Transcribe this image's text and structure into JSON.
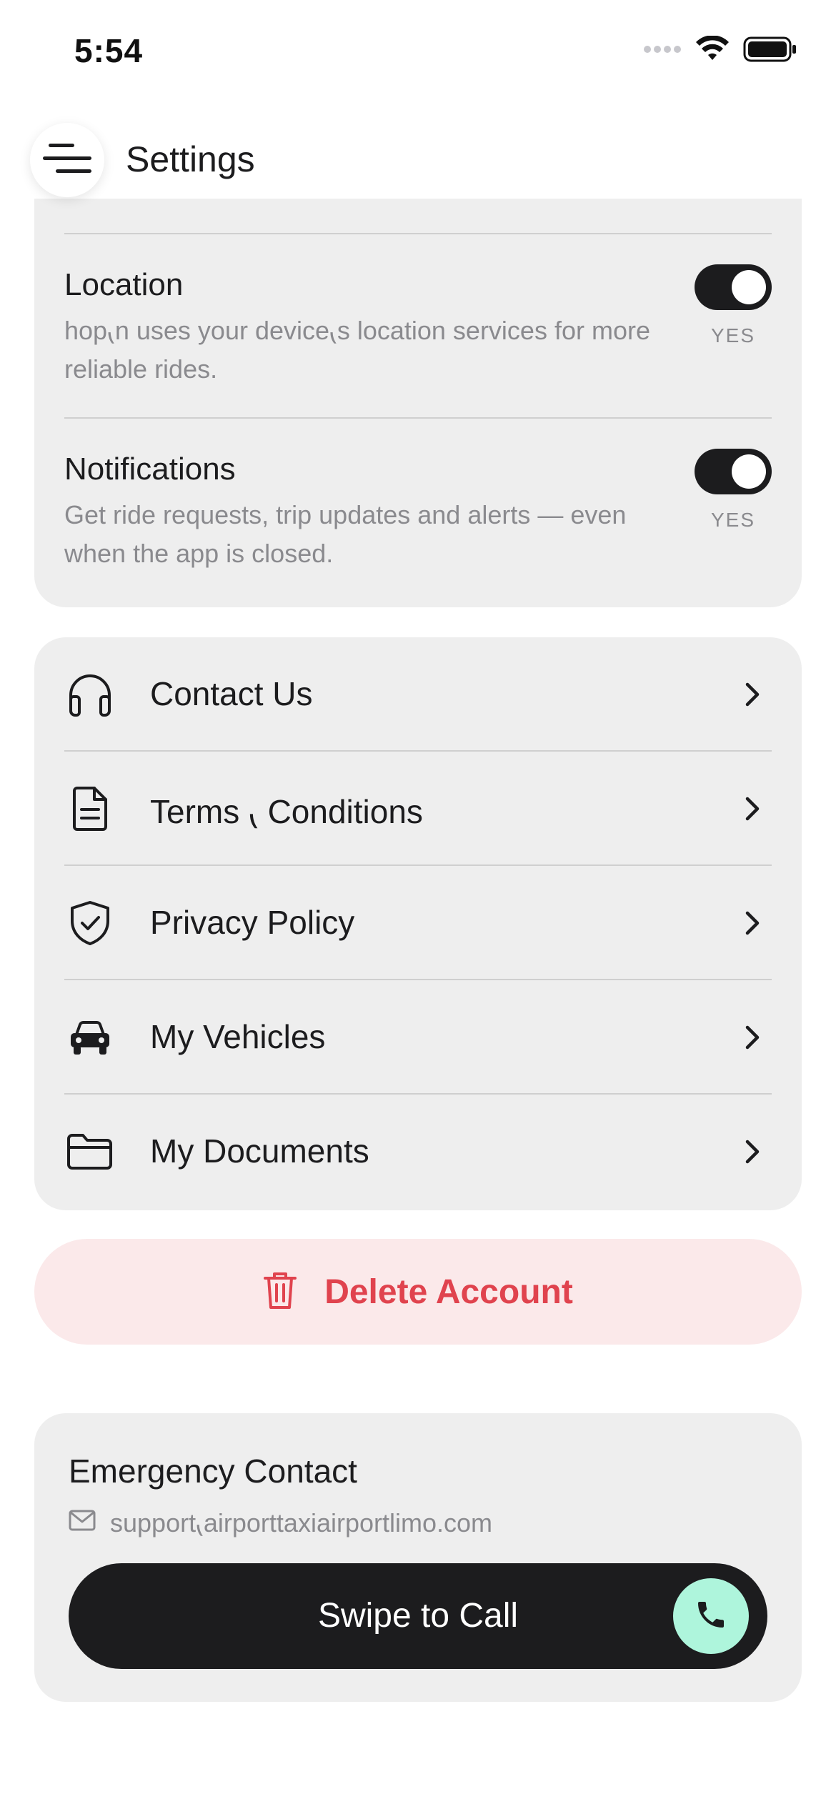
{
  "status_bar": {
    "time": "5:54"
  },
  "header": {
    "title": "Settings"
  },
  "preferences": {
    "location": {
      "title": "Location",
      "description": "hop⹛n uses your device⹛s location services for more reliable rides.",
      "state": "YES"
    },
    "notifications": {
      "title": "Notifications",
      "description": "Get ride requests, trip updates and alerts — even when the app is closed.",
      "state": "YES"
    }
  },
  "menu": {
    "items": [
      {
        "label": "Contact Us",
        "icon": "headphones-icon"
      },
      {
        "label": "Terms ⹛ Conditions",
        "icon": "document-icon"
      },
      {
        "label": "Privacy Policy",
        "icon": "shield-check-icon"
      },
      {
        "label": "My Vehicles",
        "icon": "car-icon"
      },
      {
        "label": "My Documents",
        "icon": "folder-icon"
      }
    ]
  },
  "delete_account": {
    "label": "Delete Account",
    "color": "#e0434e",
    "background": "#fbe9ea"
  },
  "emergency": {
    "title": "Emergency Contact",
    "email": "support⹛airporttaxiairportlimo.com",
    "swipe_label": "Swipe to Call",
    "handle_color": "#aef5dc"
  }
}
